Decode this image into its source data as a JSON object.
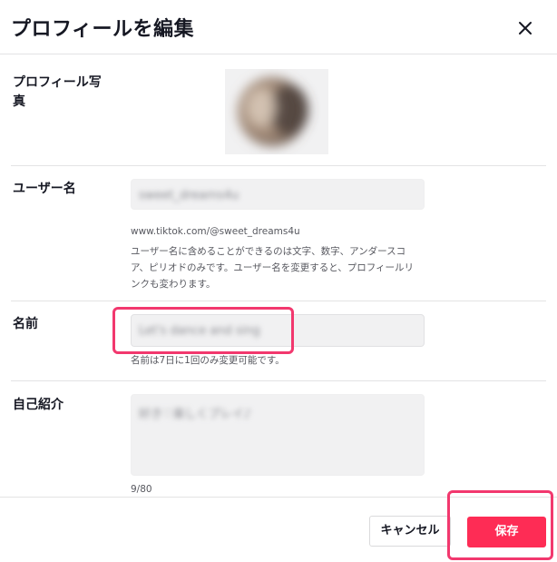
{
  "header": {
    "title": "プロフィールを編集"
  },
  "photo": {
    "label": "プロフィール写真"
  },
  "username": {
    "label": "ユーザー名",
    "value": "sweet_dreams4u",
    "url": "www.tiktok.com/@sweet_dreams4u",
    "description": "ユーザー名に含めることができるのは文字、数字、アンダースコア、ピリオドのみです。ユーザー名を変更すると、プロフィールリンクも変わります。"
  },
  "name": {
    "label": "名前",
    "value": "Let's dance and sing",
    "help": "名前は7日に1回のみ変更可能です。"
  },
  "bio": {
    "label": "自己紹介",
    "value": "好き♡楽しくプレイ♪",
    "count": "9/80"
  },
  "footer": {
    "cancel_label": "キャンセル",
    "save_label": "保存"
  },
  "colors": {
    "accent": "#fe2c55",
    "highlight": "#f2386e"
  }
}
